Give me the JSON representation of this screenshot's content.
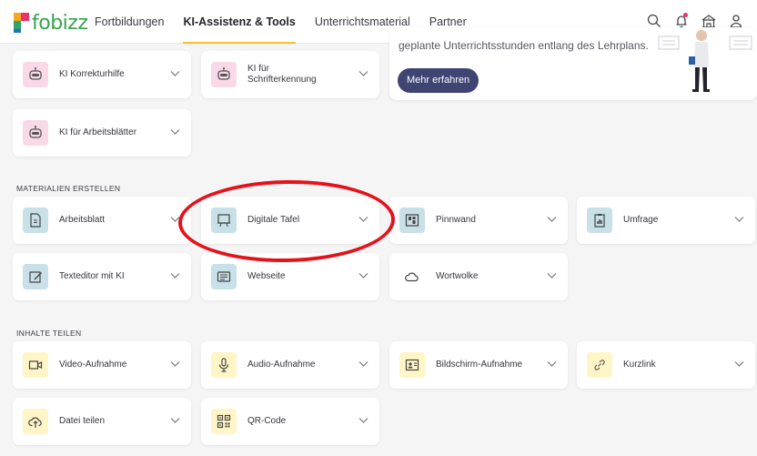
{
  "header": {
    "logo_text": "fobizz",
    "nav": [
      "Fortbildungen",
      "KI-Assistenz & Tools",
      "Unterrichtsmaterial",
      "Partner"
    ],
    "active_nav": 1,
    "icons": [
      "search-icon",
      "bell-icon",
      "school-icon",
      "user-icon"
    ],
    "notification_color": "#e8336b"
  },
  "promo": {
    "text": "geplante Unterrichtsstunden entlang des Lehrplans.",
    "button_label": "Mehr erfahren"
  },
  "ki_tools": [
    {
      "label": "KI Korrekturhilfe",
      "icon": "robot-icon"
    },
    {
      "label": "KI für Schrifterkennung",
      "icon": "robot-icon"
    },
    {
      "label": "KI für Arbeitsblätter",
      "icon": "robot-icon"
    }
  ],
  "materialien": {
    "title": "MATERIALIEN ERSTELLEN",
    "items": [
      {
        "label": "Arbeitsblatt",
        "icon": "worksheet-icon"
      },
      {
        "label": "Digitale Tafel",
        "icon": "whiteboard-icon"
      },
      {
        "label": "Pinnwand",
        "icon": "pinboard-icon"
      },
      {
        "label": "Umfrage",
        "icon": "survey-icon"
      },
      {
        "label": "Texteditor mit KI",
        "icon": "edit-icon"
      },
      {
        "label": "Webseite",
        "icon": "webpage-icon"
      },
      {
        "label": "Wortwolke",
        "icon": "cloud-icon"
      }
    ]
  },
  "inhalte": {
    "title": "INHALTE TEILEN",
    "items": [
      {
        "label": "Video-Aufnahme",
        "icon": "video-icon"
      },
      {
        "label": "Audio-Aufnahme",
        "icon": "microphone-icon"
      },
      {
        "label": "Bildschirm-Aufnahme",
        "icon": "screen-recording-icon"
      },
      {
        "label": "Kurzlink",
        "icon": "link-icon"
      },
      {
        "label": "Datei teilen",
        "icon": "upload-cloud-icon"
      },
      {
        "label": "QR-Code",
        "icon": "qr-code-icon"
      }
    ]
  },
  "colors": {
    "accent_yellow": "#f6c12c",
    "promo_button": "#3f4473",
    "annotation_red": "#e6121a",
    "ki_icon_bg": "#f9d8e7",
    "material_icon_bg": "#c8e0e8",
    "share_icon_bg": "#fff5c6"
  }
}
